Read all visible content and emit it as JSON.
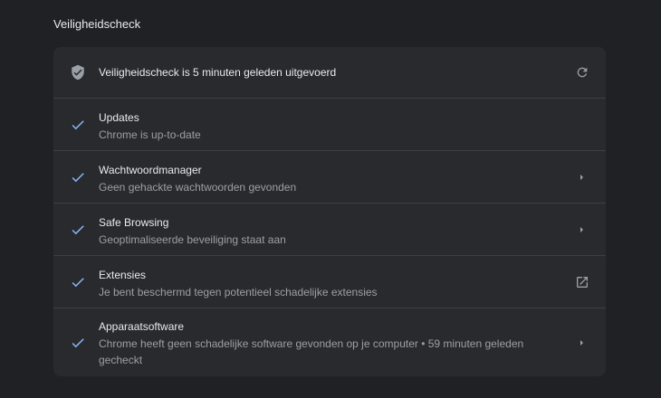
{
  "section": {
    "title": "Veiligheidscheck"
  },
  "header": {
    "status": "Veiligheidscheck is 5 minuten geleden uitgevoerd"
  },
  "items": [
    {
      "title": "Updates",
      "subtitle": "Chrome is up-to-date"
    },
    {
      "title": "Wachtwoordmanager",
      "subtitle": "Geen gehackte wachtwoorden gevonden"
    },
    {
      "title": "Safe Browsing",
      "subtitle": "Geoptimaliseerde beveiliging staat aan"
    },
    {
      "title": "Extensies",
      "subtitle": "Je bent beschermd tegen potentieel schadelijke extensies"
    },
    {
      "title": "Apparaatsoftware",
      "subtitle": "Chrome heeft geen schadelijke software gevonden op je computer • 59 minuten geleden gecheckt"
    }
  ],
  "colors": {
    "background": "#202124",
    "card": "#292a2d",
    "check": "#8ab4f8",
    "text_primary": "#e8eaed",
    "text_secondary": "#9aa0a6"
  },
  "icons": {
    "header": "shield-check-icon",
    "refresh": "refresh-icon",
    "item_status": "checkmark-icon",
    "navigate": "chevron-right-icon",
    "external": "open-in-new-icon"
  }
}
